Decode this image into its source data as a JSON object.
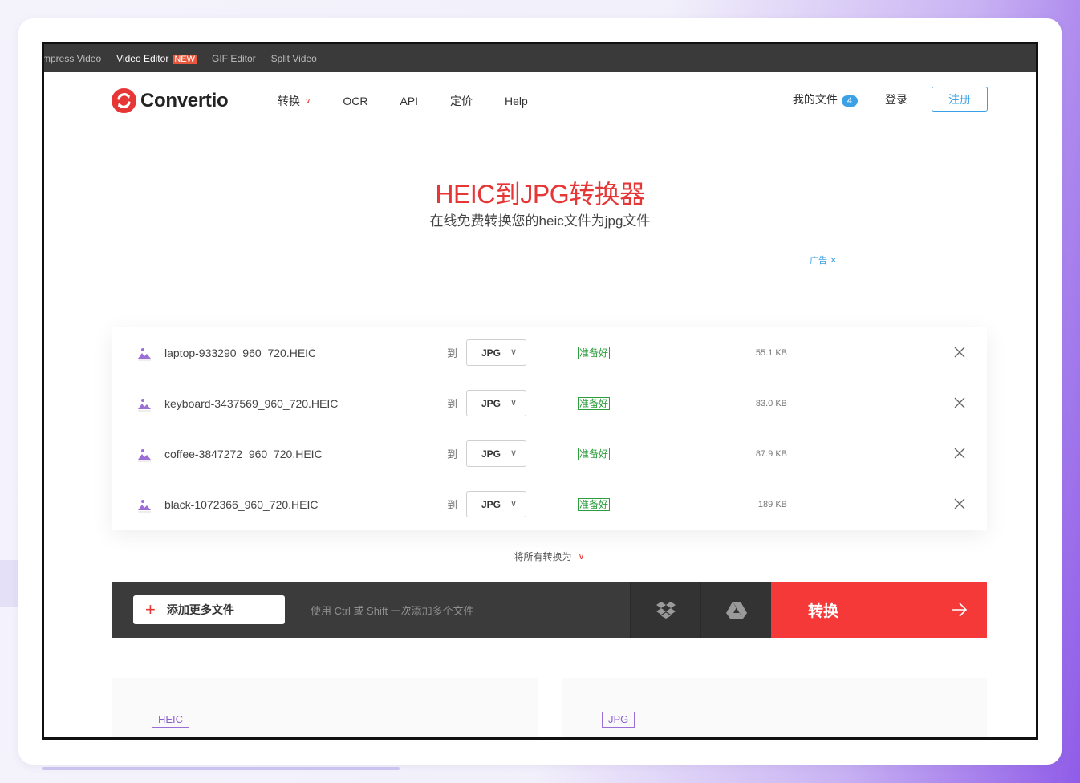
{
  "topstrip": {
    "tabs": [
      "mpress Video",
      "Video Editor",
      "GIF Editor",
      "Split Video"
    ],
    "new_badge": "NEW"
  },
  "nav": {
    "brand": "Convertio",
    "menu": [
      "转换",
      "OCR",
      "API",
      "定价",
      "Help"
    ],
    "my_files": "我的文件",
    "my_files_count": "4",
    "login": "登录",
    "signup": "注册"
  },
  "hero": {
    "title": "HEIC到JPG转换器",
    "subtitle": "在线免费转换您的heic文件为jpg文件",
    "ad_label": "广告"
  },
  "files": [
    {
      "name": "laptop-933290_960_720.HEIC",
      "to": "到",
      "format": "JPG",
      "status": "准备好",
      "size": "55.1 KB"
    },
    {
      "name": "keyboard-3437569_960_720.HEIC",
      "to": "到",
      "format": "JPG",
      "status": "准备好",
      "size": "83.0 KB"
    },
    {
      "name": "coffee-3847272_960_720.HEIC",
      "to": "到",
      "format": "JPG",
      "status": "准备好",
      "size": "87.9 KB"
    },
    {
      "name": "black-1072366_960_720.HEIC",
      "to": "到",
      "format": "JPG",
      "status": "准备好",
      "size": "189 KB"
    }
  ],
  "convert_all": "将所有转换为",
  "actions": {
    "add_files": "添加更多文件",
    "hint": "使用 Ctrl 或 Shift 一次添加多个文件",
    "convert": "转换"
  },
  "format_cards": [
    "HEIC",
    "JPG"
  ],
  "colors": {
    "accent": "#e63635",
    "convert": "#f53838",
    "ready": "#2e9d3e",
    "link": "#3aa1e6",
    "tag": "#8b5fd0"
  }
}
